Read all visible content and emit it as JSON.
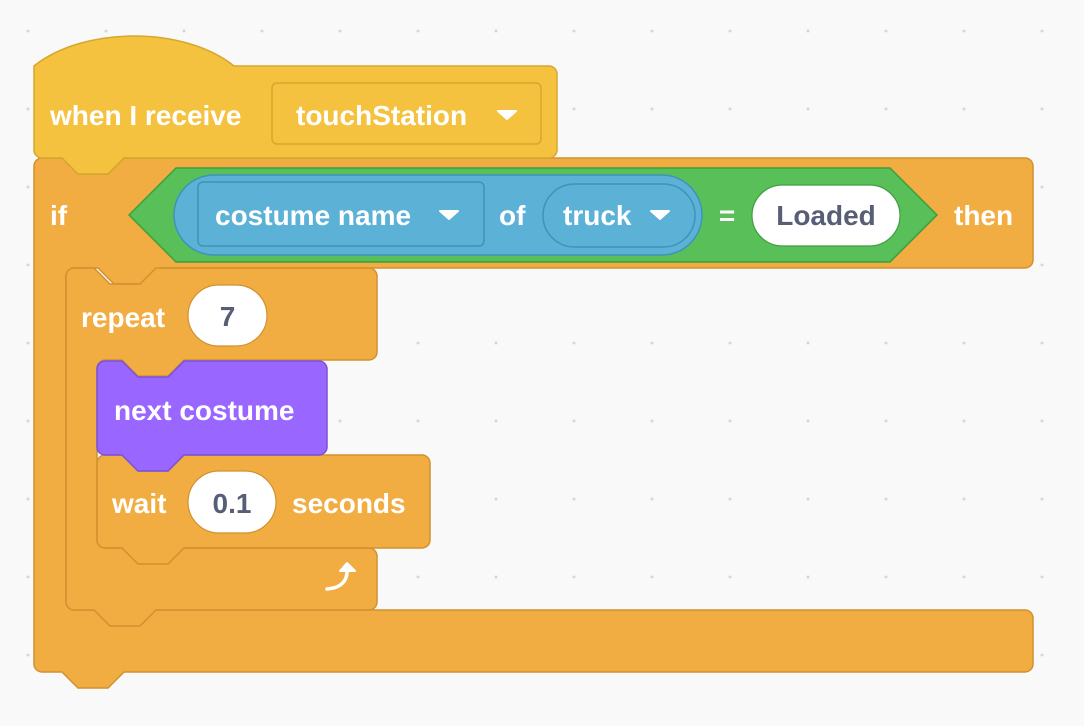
{
  "colors": {
    "events": "#f5c23f",
    "events_border": "#d6a72d",
    "control": "#f2ad42",
    "control_border": "#d0912f",
    "looks": "#9966ff",
    "looks_border": "#7b52d6",
    "sensing": "#5cb1d6",
    "sensing_border": "#3f93b9",
    "operators": "#59c059",
    "operators_border": "#3e9e3e",
    "workspace": "#f9f9f9"
  },
  "hat_block": {
    "label": "when I receive",
    "message_dropdown": "touchStation",
    "dropdown_icon": "triangle-down-icon"
  },
  "if_block": {
    "label_if": "if",
    "label_then": "then",
    "condition": {
      "operator": "=",
      "left": {
        "attribute_dropdown": "costume name",
        "of_label": "of",
        "sprite_dropdown": "truck"
      },
      "right_value": "Loaded"
    }
  },
  "repeat_block": {
    "label": "repeat",
    "count": "7",
    "loop_icon": "loop-arrow-icon"
  },
  "next_costume_block": {
    "label": "next costume"
  },
  "wait_block": {
    "label_wait": "wait",
    "value": "0.1",
    "label_seconds": "seconds"
  }
}
